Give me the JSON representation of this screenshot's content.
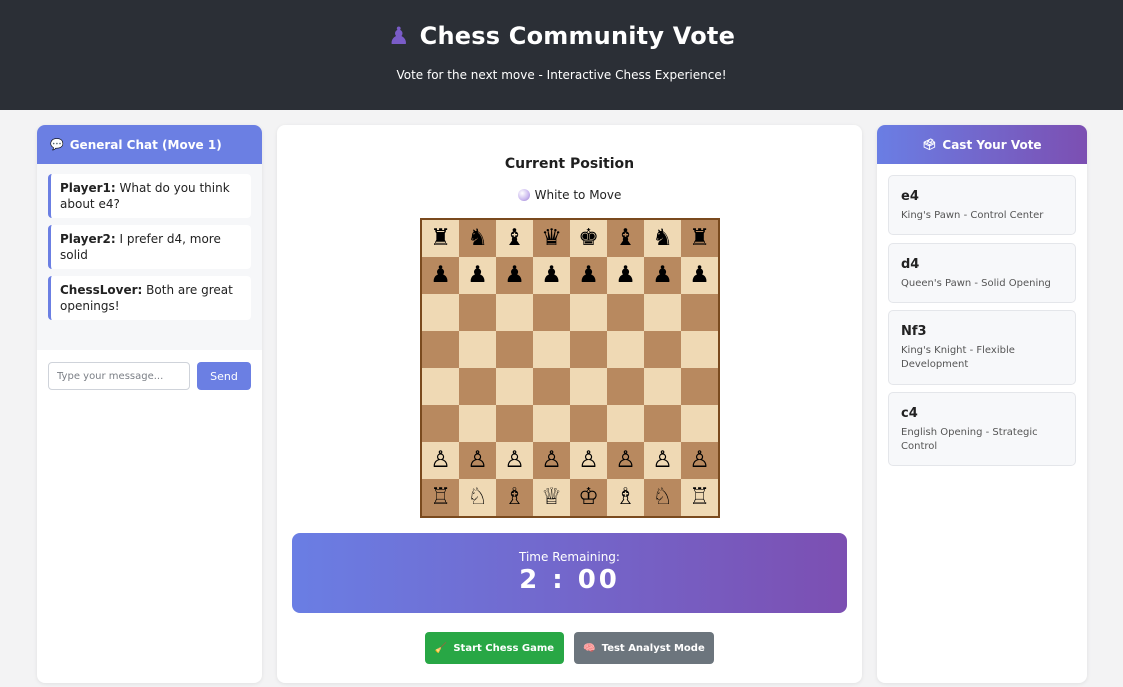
{
  "header": {
    "title": "Chess Community Vote",
    "subtitle": "Vote for the next move - Interactive Chess Experience!",
    "icon": "pawn-icon"
  },
  "chat": {
    "title": "General Chat (Move 1)",
    "icon": "speech-bubble-icon",
    "messages": [
      {
        "user": "Player1:",
        "text": "What do you think about e4?"
      },
      {
        "user": "Player2:",
        "text": "I prefer d4, more solid"
      },
      {
        "user": "ChessLover:",
        "text": "Both are great openings!"
      }
    ],
    "input_placeholder": "Type your message...",
    "send_label": "Send"
  },
  "board_panel": {
    "title": "Current Position",
    "turn": "White to Move",
    "board": [
      [
        "♜",
        "♞",
        "♝",
        "♛",
        "♚",
        "♝",
        "♞",
        "♜"
      ],
      [
        "♟",
        "♟",
        "♟",
        "♟",
        "♟",
        "♟",
        "♟",
        "♟"
      ],
      [
        "",
        "",
        "",
        "",
        "",
        "",
        "",
        ""
      ],
      [
        "",
        "",
        "",
        "",
        "",
        "",
        "",
        ""
      ],
      [
        "",
        "",
        "",
        "",
        "",
        "",
        "",
        ""
      ],
      [
        "",
        "",
        "",
        "",
        "",
        "",
        "",
        ""
      ],
      [
        "♙",
        "♙",
        "♙",
        "♙",
        "♙",
        "♙",
        "♙",
        "♙"
      ],
      [
        "♖",
        "♘",
        "♗",
        "♕",
        "♔",
        "♗",
        "♘",
        "♖"
      ]
    ],
    "light_color": "#efd9b4",
    "dark_color": "#b8895f"
  },
  "timer": {
    "label": "Time Remaining:",
    "value": "2 : 00"
  },
  "buttons": {
    "start_label": "Start Chess Game",
    "test_label": "Test Analyst Mode"
  },
  "vote": {
    "title": "Cast Your Vote",
    "icon": "ballot-box-icon",
    "options": [
      {
        "move": "e4",
        "desc": "King's Pawn - Control Center"
      },
      {
        "move": "d4",
        "desc": "Queen's Pawn - Solid Opening"
      },
      {
        "move": "Nf3",
        "desc": "King's Knight - Flexible Development"
      },
      {
        "move": "c4",
        "desc": "English Opening - Strategic Control"
      }
    ]
  },
  "colors": {
    "accent": "#6b7fe3",
    "gradient_end": "#7c4fb2",
    "start_button": "#28a745",
    "test_button": "#6c757d",
    "header_bg": "#2b2f36"
  }
}
